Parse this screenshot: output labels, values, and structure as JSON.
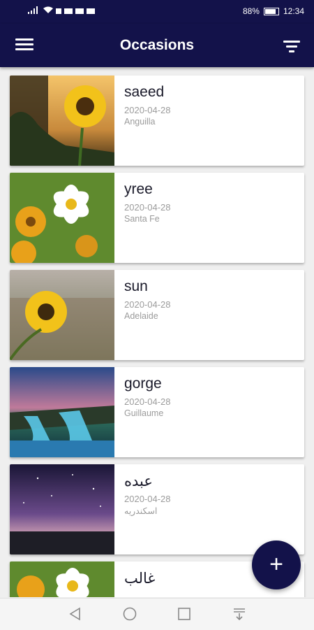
{
  "status": {
    "battery": "88%",
    "time": "12:34"
  },
  "appbar": {
    "title": "Occasions",
    "menu_icon": "menu-icon",
    "filter_icon": "filter-icon"
  },
  "occasions": [
    {
      "name": "saeed",
      "date": "2020-04-28",
      "place": "Anguilla",
      "image": "sunflower-sunset"
    },
    {
      "name": "yree",
      "date": "2020-04-28",
      "place": "Santa Fe",
      "image": "white-flower-field"
    },
    {
      "name": "sun",
      "date": "2020-04-28",
      "place": "Adelaide",
      "image": "sunflower-field"
    },
    {
      "name": "gorge",
      "date": "2020-04-28",
      "place": "Guillaume",
      "image": "waterfall"
    },
    {
      "name": "عبده",
      "date": "2020-04-28",
      "place": "اسكندريه",
      "image": "night-sky"
    },
    {
      "name": "غالب",
      "date": "",
      "place": "",
      "image": "white-flower-field"
    }
  ],
  "fab": {
    "label": "+"
  },
  "navbar": {
    "icons": [
      "back-icon",
      "home-icon",
      "recents-icon",
      "notification-pull-icon"
    ]
  },
  "colors": {
    "primary": "#13124a",
    "background": "#efefef",
    "card": "#ffffff",
    "secondary_text": "#9b9b9b"
  }
}
